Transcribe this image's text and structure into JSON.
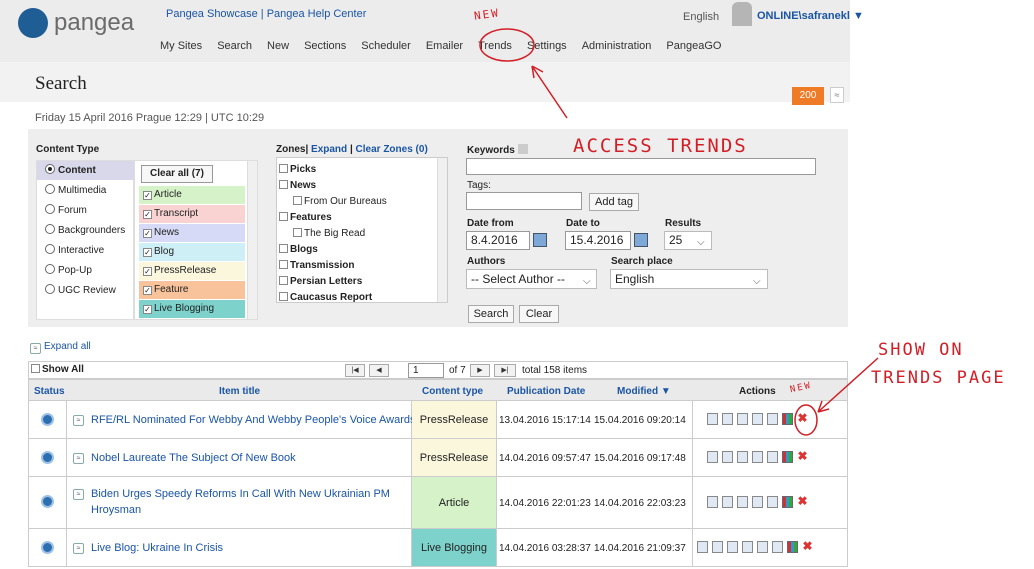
{
  "app": {
    "name": "pangea",
    "brand_color": "#1f5d95",
    "accent": "#f07b26"
  },
  "header": {
    "top_links": "Pangea Showcase | Pangea Help Center",
    "language": "English",
    "user": "ONLINE\\safranekl ▼",
    "nav": [
      "My Sites",
      "Search",
      "New",
      "Sections",
      "Scheduler",
      "Emailer",
      "Trends",
      "Settings",
      "Administration",
      "PangeaGO"
    ]
  },
  "page": {
    "title": "Search",
    "count_badge": "200",
    "collapse_glyph": "≈",
    "datetime": "Friday 15 April 2016 Prague 12:29 | UTC 10:29"
  },
  "filters": {
    "content_type_label": "Content Type",
    "content_types": [
      "Content",
      "Multimedia",
      "Forum",
      "Backgrounders",
      "Interactive",
      "Pop-Up",
      "UGC Review"
    ],
    "clear_all": "Clear all (7)",
    "subtypes": [
      {
        "label": "Article",
        "color": "#d6f2c8"
      },
      {
        "label": "Transcript",
        "color": "#f9d2d2"
      },
      {
        "label": "News",
        "color": "#d6daf6"
      },
      {
        "label": "Blog",
        "color": "#cfeff6"
      },
      {
        "label": "PressRelease",
        "color": "#fbf7dd"
      },
      {
        "label": "Feature",
        "color": "#f8c39b"
      },
      {
        "label": "Live Blogging",
        "color": "#7dd3cc"
      }
    ],
    "zones_label": "Zones|",
    "zones_expand": "Expand",
    "zones_sep": "|",
    "zones_clear": "Clear Zones (0)",
    "zones": [
      "Picks",
      "News",
      "From Our Bureaus",
      "Features",
      "The Big Read",
      "Blogs",
      "Transmission",
      "Persian Letters",
      "Caucasus Report"
    ],
    "keywords_label": "Keywords",
    "tags_label": "Tags:",
    "add_tag": "Add tag",
    "date_from_label": "Date from",
    "date_from": "8.4.2016",
    "date_to_label": "Date to",
    "date_to": "15.4.2016",
    "results_label": "Results",
    "results": "25",
    "authors_label": "Authors",
    "author_select": "-- Select Author --",
    "search_place_label": "Search place",
    "search_place": "English",
    "search_btn": "Search",
    "clear_btn": "Clear"
  },
  "results": {
    "expand_all": "Expand all",
    "show_all": "Show All",
    "page": "1",
    "of_pages": "of 7",
    "total": "total 158 items",
    "columns": [
      "Status",
      "Item title",
      "Content type",
      "Publication Date",
      "Modified ▼",
      "Actions"
    ],
    "rows": [
      {
        "title": "RFE/RL Nominated For Webby And Webby People's Voice Awards",
        "title2": "",
        "type": "PressRelease",
        "type_color": "#fbf7dd",
        "published": "13.04.2016 15:17:14",
        "modified": "15.04.2016 09:20:14"
      },
      {
        "title": "Nobel Laureate The Subject Of New Book",
        "title2": "",
        "type": "PressRelease",
        "type_color": "#fbf7dd",
        "published": "14.04.2016 09:57:47",
        "modified": "15.04.2016 09:17:48"
      },
      {
        "title": "Biden Urges Speedy Reforms In Call With New Ukrainian PM",
        "title2": "Hroysman",
        "type": "Article",
        "type_color": "#d6f2c8",
        "published": "14.04.2016 22:01:23",
        "modified": "14.04.2016 22:03:23"
      },
      {
        "title": "Live Blog: Ukraine In Crisis",
        "title2": "",
        "type": "Live Blogging",
        "type_color": "#7dd3cc",
        "published": "14.04.2016 03:28:37",
        "modified": "14.04.2016 21:09:37"
      }
    ]
  },
  "annotations": {
    "new_nav": "NEW",
    "access": "ACCESS TRENDS",
    "new_actions": "NEW",
    "show1": "SHOW ON",
    "show2": "TRENDS PAGE",
    "color": "#d21f26"
  }
}
